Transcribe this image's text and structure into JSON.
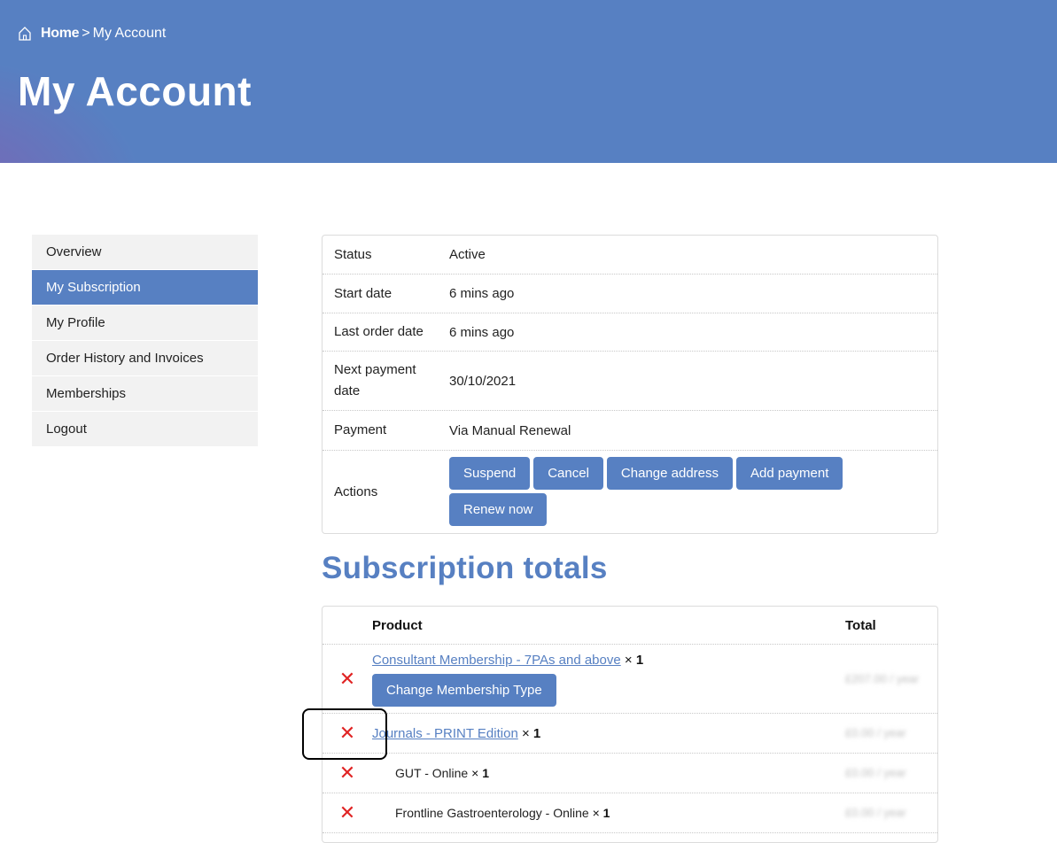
{
  "header": {
    "breadcrumb": {
      "home": "Home",
      "separator": ">",
      "current": "My Account"
    },
    "title": "My Account"
  },
  "sidebar": {
    "items": [
      {
        "label": "Overview",
        "active": false
      },
      {
        "label": "My Subscription",
        "active": true
      },
      {
        "label": "My Profile",
        "active": false
      },
      {
        "label": "Order History and Invoices",
        "active": false
      },
      {
        "label": "Memberships",
        "active": false
      },
      {
        "label": "Logout",
        "active": false
      }
    ]
  },
  "subscription": {
    "status_label": "Status",
    "status_value": "Active",
    "start_label": "Start date",
    "start_value": "6 mins ago",
    "last_order_label": "Last order date",
    "last_order_value": "6 mins ago",
    "next_payment_label": "Next payment date",
    "next_payment_value": "30/10/2021",
    "payment_label": "Payment",
    "payment_value": "Via Manual Renewal",
    "actions_label": "Actions",
    "actions": {
      "suspend": "Suspend",
      "cancel": "Cancel",
      "change_address": "Change address",
      "add_payment": "Add payment",
      "renew_now": "Renew now"
    }
  },
  "totals": {
    "title": "Subscription totals",
    "header_product": "Product",
    "header_total": "Total",
    "rows": [
      {
        "product": "Consultant Membership - 7PAs and above",
        "qty_sep": "×",
        "qty": "1",
        "button": "Change Membership Type",
        "total": "£207.00 / year"
      },
      {
        "product": "Journals - PRINT Edition",
        "qty_sep": "×",
        "qty": "1",
        "total": "£0.00 / year"
      },
      {
        "product": "GUT - Online",
        "qty_sep": "×",
        "qty": "1",
        "total": "£0.00 / year"
      },
      {
        "product": "Frontline Gastroenterology - Online",
        "qty_sep": "×",
        "qty": "1",
        "total": "£0.00 / year"
      }
    ],
    "remove_symbol": "✕"
  },
  "colors": {
    "brand": "#5780c2",
    "remove": "#e02424"
  },
  "icons": {
    "home": "home-icon",
    "remove": "close-icon"
  }
}
